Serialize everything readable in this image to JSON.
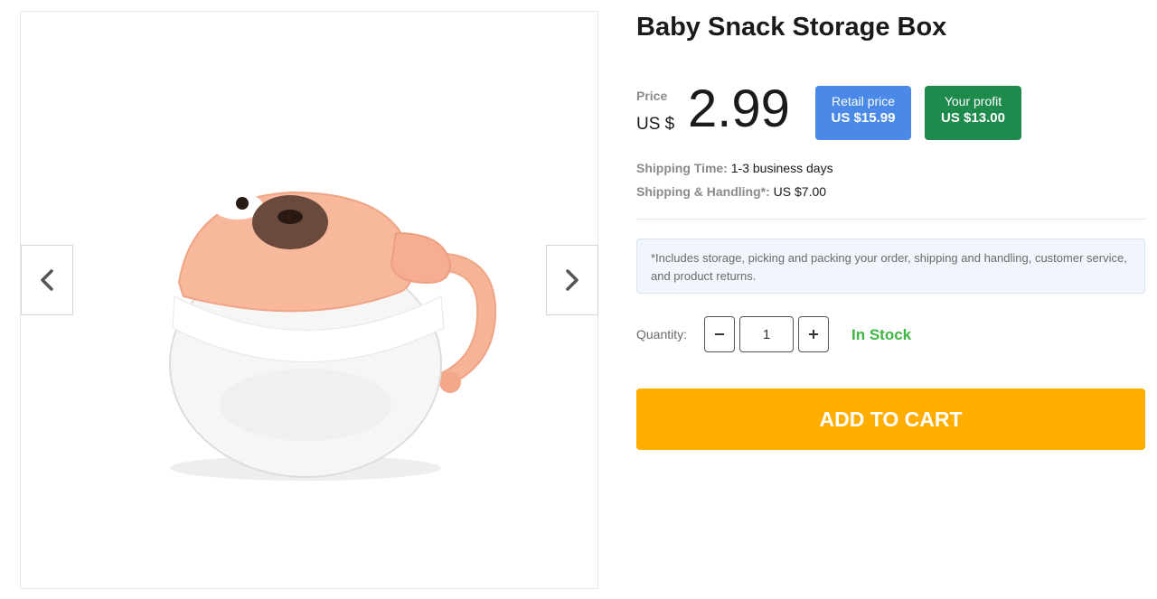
{
  "gallery": {
    "prev_icon": "chevron-left-icon",
    "next_icon": "chevron-right-icon",
    "image_subject": "product-photo"
  },
  "product": {
    "title": "Baby Snack Storage Box",
    "price_label": "Price",
    "currency": "US $",
    "price": "2.99",
    "retail": {
      "label": "Retail price",
      "value": "US $15.99",
      "color": "#4a89e8"
    },
    "profit": {
      "label": "Your profit",
      "value": "US $13.00",
      "color": "#1e8a4c"
    }
  },
  "shipping": {
    "time_label": "Shipping Time:",
    "time_value": "1-3 business days",
    "handling_label": "Shipping & Handling*:",
    "handling_value": "US $7.00"
  },
  "notice": "*Includes storage, picking and packing your order, shipping and handling, customer service, and product returns.",
  "quantity": {
    "label": "Quantity:",
    "value": "1",
    "minus_icon": "minus-icon",
    "plus_icon": "plus-icon"
  },
  "stock_status": "In Stock",
  "stock_color": "#3fb544",
  "cart": {
    "label": "ADD TO CART",
    "color": "#ffae00"
  }
}
